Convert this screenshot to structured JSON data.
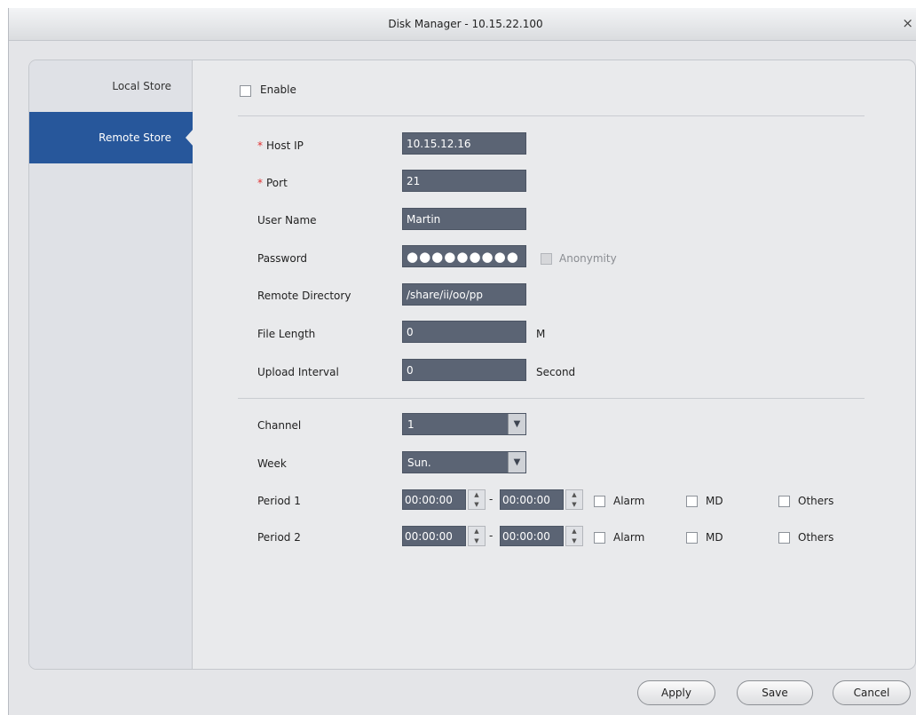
{
  "window": {
    "title": "Disk Manager - 10.15.22.100",
    "close_icon": "×"
  },
  "sidebar": {
    "items": [
      {
        "label": "Local Store",
        "active": false
      },
      {
        "label": "Remote Store",
        "active": true
      }
    ]
  },
  "form": {
    "enable": {
      "label": "Enable",
      "checked": false
    },
    "required_mark": "*",
    "host_ip": {
      "label": "Host IP",
      "value": "10.15.12.16"
    },
    "port": {
      "label": "Port",
      "value": "21"
    },
    "user_name": {
      "label": "User Name",
      "value": "Martin"
    },
    "password": {
      "label": "Password",
      "value": "●●●●●●●●●"
    },
    "anonymity": {
      "label": "Anonymity",
      "checked": false,
      "disabled": true
    },
    "remote_directory": {
      "label": "Remote Directory",
      "value": "/share/ii/oo/pp"
    },
    "file_length": {
      "label": "File Length",
      "value": "0",
      "unit": "M"
    },
    "upload_interval": {
      "label": "Upload Interval",
      "value": "0",
      "unit": "Second"
    },
    "channel": {
      "label": "Channel",
      "value": "1"
    },
    "week": {
      "label": "Week",
      "value": "Sun."
    },
    "periods": [
      {
        "label": "Period 1",
        "start": "00:00:00",
        "end": "00:00:00",
        "alarm": "Alarm",
        "md": "MD",
        "others": "Others"
      },
      {
        "label": "Period 2",
        "start": "00:00:00",
        "end": "00:00:00",
        "alarm": "Alarm",
        "md": "MD",
        "others": "Others"
      }
    ],
    "range_separator": "-"
  },
  "buttons": {
    "apply": "Apply",
    "save": "Save",
    "cancel": "Cancel"
  },
  "colors": {
    "accent": "#27579b",
    "field_bg": "#5b6474",
    "required": "#e03030"
  }
}
